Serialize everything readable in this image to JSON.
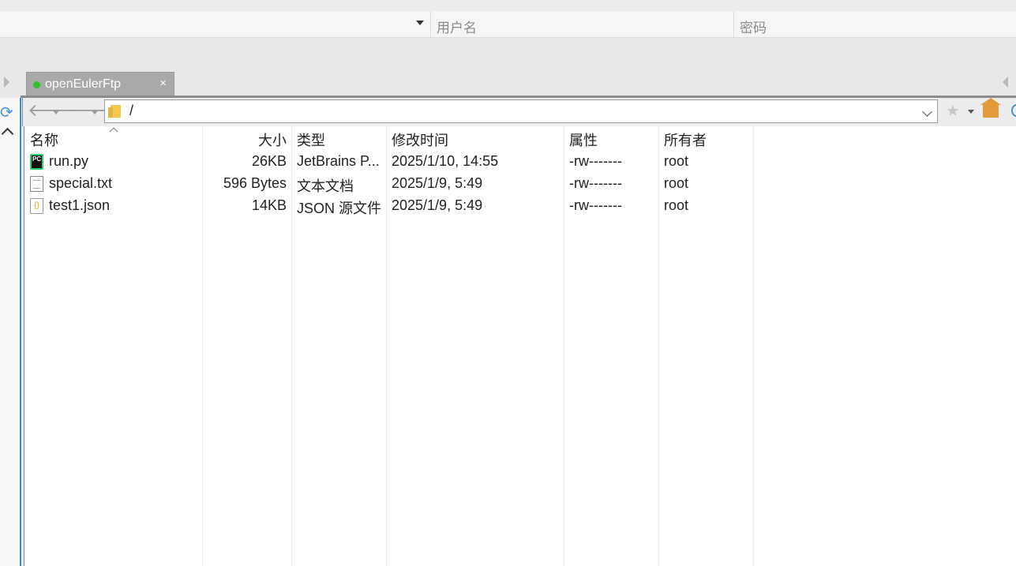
{
  "connection": {
    "username_placeholder": "用户名",
    "password_placeholder": "密码"
  },
  "tab": {
    "label": "openEulerFtp",
    "close_glyph": "×"
  },
  "toolbar": {
    "back_glyph": "🡐",
    "forward_glyph": "🡒",
    "path": "/",
    "star_glyph": "★"
  },
  "columns": [
    "名称",
    "大小",
    "类型",
    "修改时间",
    "属性",
    "所有者"
  ],
  "files": [
    {
      "name": "run.py",
      "size": "26KB",
      "type": "JetBrains P...",
      "modified": "2025/1/10, 14:55",
      "attributes": "-rw-------",
      "owner": "root",
      "icon": "pycharm-file-icon",
      "icon_text": "PC"
    },
    {
      "name": "special.txt",
      "size": "596 Bytes",
      "type": "文本文档",
      "modified": "2025/1/9, 5:49",
      "attributes": "-rw-------",
      "owner": "root",
      "icon": "text-file-icon",
      "icon_text": ""
    },
    {
      "name": "test1.json",
      "size": "14KB",
      "type": "JSON 源文件",
      "modified": "2025/1/9, 5:49",
      "attributes": "-rw-------",
      "owner": "root",
      "icon": "json-file-icon",
      "icon_text": "{}"
    }
  ],
  "colors": {
    "accent": "#3c8ad6",
    "tab_active": "#a9a9a9",
    "online_dot": "#2fbf2f"
  }
}
